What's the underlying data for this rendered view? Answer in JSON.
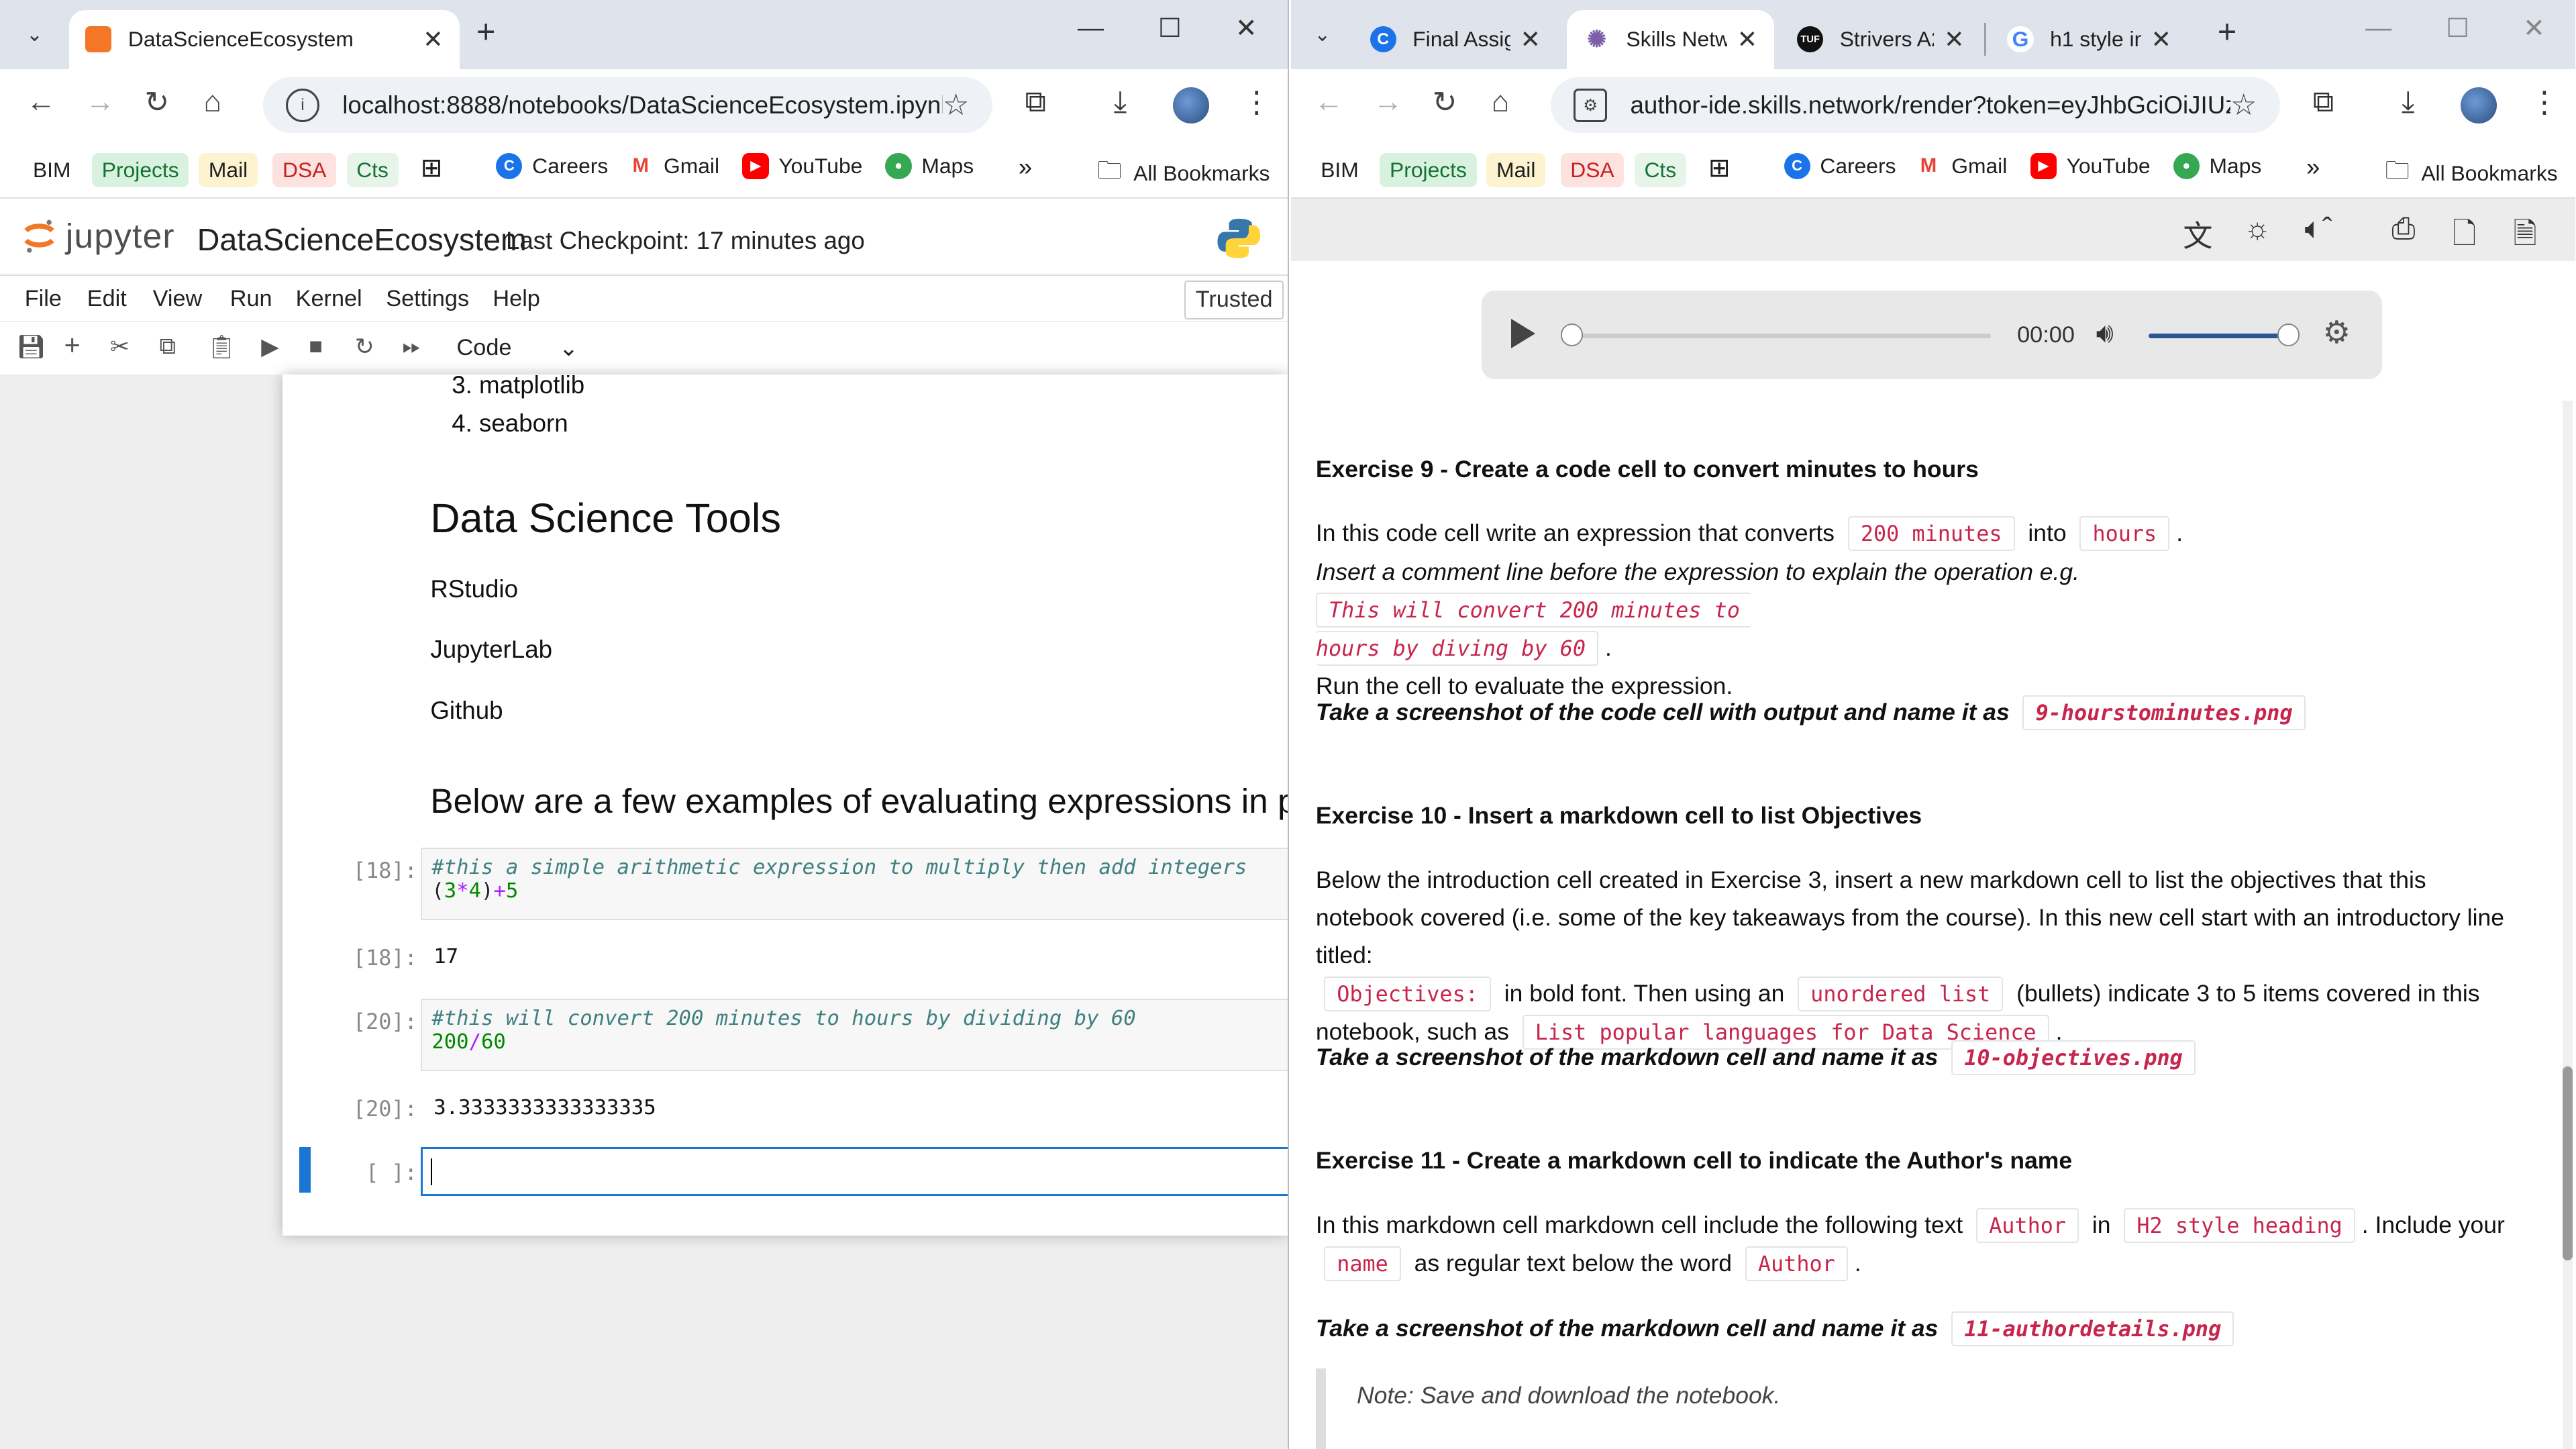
{
  "left": {
    "tab": {
      "title": "DataScienceEcosystem",
      "favicon_color": "#f37726"
    },
    "address": {
      "url": "localhost:8888/notebooks/DataScienceEcosystem.ipynb"
    },
    "bookmarks": [
      {
        "label": "BIM",
        "bg": ""
      },
      {
        "label": "Projects",
        "bg": "#d9f2e0",
        "color": "#137333"
      },
      {
        "label": "Mail",
        "bg": "#fdf3d0",
        "color": "#1f1f1f"
      },
      {
        "label": "DSA",
        "bg": "#fde2e0",
        "color": "#c5221f"
      },
      {
        "label": "Cts",
        "bg": "#e6f4ea",
        "color": "#137333"
      },
      {
        "label": "Careers",
        "icon": "C",
        "icon_color": "#1a73e8"
      },
      {
        "label": "Gmail",
        "icon": "M",
        "icon_color": "#ea4335"
      },
      {
        "label": "YouTube",
        "icon": "▶",
        "icon_color": "#ff0000"
      },
      {
        "label": "Maps",
        "icon": "●",
        "icon_color": "#34a853"
      }
    ],
    "all_bookmarks": "All Bookmarks",
    "jupyter": {
      "brand": "jupyter",
      "notebook_title": "DataScienceEcosystem",
      "checkpoint": "Last Checkpoint: 17 minutes ago",
      "menu": [
        "File",
        "Edit",
        "View",
        "Run",
        "Kernel",
        "Settings",
        "Help"
      ],
      "trusted": "Trusted",
      "cell_type": "Code",
      "list_items": [
        "matplotlib",
        "seaborn"
      ],
      "list_numbers": [
        "3.",
        "4."
      ],
      "tools_heading": "Data Science Tools",
      "tools": [
        "RStudio",
        "JupyterLab",
        "Github"
      ],
      "examples_heading": "Below are a few examples of evaluating expressions in p",
      "cells": [
        {
          "in_prompt": "[18]:",
          "comment": "#this a simple arithmetic expression to multiply then add integers",
          "code": {
            "a": "(",
            "b": "3",
            "c": "*",
            "d": "4",
            "e": ")",
            "f": "+",
            "g": "5"
          },
          "out_prompt": "[18]:",
          "output": "17"
        },
        {
          "in_prompt": "[20]:",
          "comment": "#this will convert 200 minutes to hours by dividing by 60",
          "code": {
            "a": "200",
            "b": "/",
            "c": "60"
          },
          "out_prompt": "[20]:",
          "output": "3.3333333333333335"
        }
      ],
      "empty_prompt": "[ ]:"
    }
  },
  "right": {
    "tabs": [
      {
        "title": "Final Assig",
        "favicon": "C",
        "favicon_color": "#1a73e8"
      },
      {
        "title": "Skills Netw",
        "favicon": "✺",
        "favicon_color": "#7b5ea7"
      },
      {
        "title": "Strivers A2",
        "favicon": "TUF",
        "favicon_color": "#111111"
      },
      {
        "title": "h1 style in",
        "favicon": "G",
        "favicon_color": "#4285f4"
      }
    ],
    "address": {
      "url": "author-ide.skills.network/render?token=eyJhbGciOiJIUz..."
    },
    "player": {
      "time": "00:00",
      "seek_progress": 0,
      "volume": 1.0
    },
    "exercises": [
      {
        "heading": "Exercise 9 - Create a code cell to convert minutes to hours",
        "p1_a": "In this code cell write an expression that converts",
        "chip1": "200 minutes",
        "p1_b": "into",
        "chip2": "hours",
        "p1_c": ".",
        "p2_a": "Insert a comment line before the expression to explain the operation e.g.",
        "chip3a": "This will convert 200 minutes to",
        "chip3b": "hours by diving by 60",
        "p2_b": ".",
        "p3": "Run the cell to evaluate the expression.",
        "shot": "Take a screenshot of the code cell with output and name it as",
        "shot_file": "9-hourstominutes.png"
      },
      {
        "heading": "Exercise 10 - Insert a markdown cell to list Objectives",
        "p1": "Below the introduction cell created in Exercise 3, insert a new markdown cell to list the objectives that this notebook covered (i.e. some of the key takeaways from the course). In this new cell start with an introductory line titled:",
        "chip1": "Objectives:",
        "p2_a": "in bold font. Then using an",
        "chip2": "unordered list",
        "p2_b": "(bullets) indicate 3 to 5 items covered in this notebook, such as",
        "chip3": "List popular languages for Data Science",
        "p2_c": ".",
        "shot": "Take a screenshot of the markdown cell and name it as",
        "shot_file": "10-objectives.png"
      },
      {
        "heading": "Exercise 11 - Create a markdown cell to indicate the Author's name",
        "p1_a": "In this markdown cell markdown cell include the following text",
        "chip1": "Author",
        "p1_b": "in",
        "chip2": "H2 style heading",
        "p1_c": ". Include your",
        "chip3": "name",
        "p1_d": "as regular text below the word",
        "chip4": "Author",
        "p1_e": ".",
        "shot": "Take a screenshot of the markdown cell and name it as",
        "shot_file": "11-authordetails.png"
      }
    ],
    "note": "Note: Save and download the notebook."
  }
}
